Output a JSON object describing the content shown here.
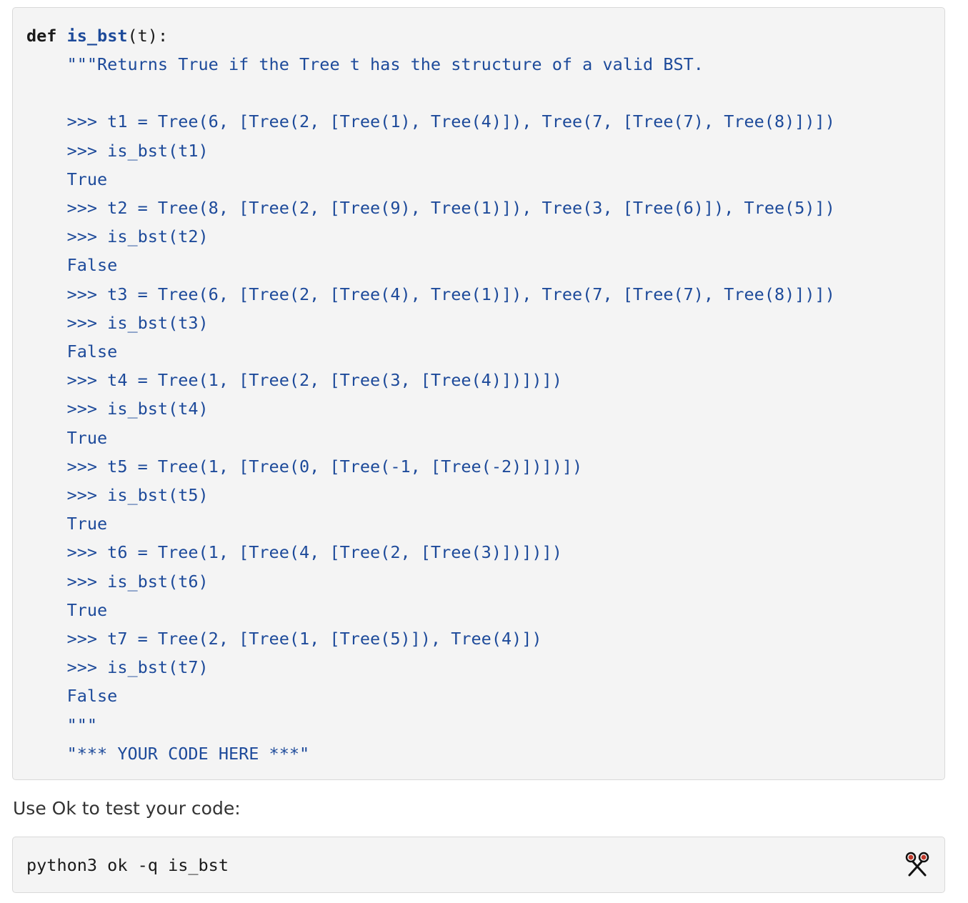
{
  "code_block": {
    "def_keyword": "def",
    "function_name": "is_bst",
    "signature_rest": "(t):",
    "lines": [
      "    \"\"\"Returns True if the Tree t has the structure of a valid BST.",
      "",
      "    >>> t1 = Tree(6, [Tree(2, [Tree(1), Tree(4)]), Tree(7, [Tree(7), Tree(8)])])",
      "    >>> is_bst(t1)",
      "    True",
      "    >>> t2 = Tree(8, [Tree(2, [Tree(9), Tree(1)]), Tree(3, [Tree(6)]), Tree(5)])",
      "    >>> is_bst(t2)",
      "    False",
      "    >>> t3 = Tree(6, [Tree(2, [Tree(4), Tree(1)]), Tree(7, [Tree(7), Tree(8)])])",
      "    >>> is_bst(t3)",
      "    False",
      "    >>> t4 = Tree(1, [Tree(2, [Tree(3, [Tree(4)])])])",
      "    >>> is_bst(t4)",
      "    True",
      "    >>> t5 = Tree(1, [Tree(0, [Tree(-1, [Tree(-2)])])])",
      "    >>> is_bst(t5)",
      "    True",
      "    >>> t6 = Tree(1, [Tree(4, [Tree(2, [Tree(3)])])])",
      "    >>> is_bst(t6)",
      "    True",
      "    >>> t7 = Tree(2, [Tree(1, [Tree(5)]), Tree(4)])",
      "    >>> is_bst(t7)",
      "    False",
      "    \"\"\"",
      "    \"*** YOUR CODE HERE ***\""
    ]
  },
  "instruction_text": "Use Ok to test your code:",
  "command_block": {
    "command": "python3 ok -q is_bst",
    "copy_icon": "scissors-icon"
  },
  "colors": {
    "code_background": "#f4f4f4",
    "code_border": "#d9d9d9",
    "docstring_blue": "#1d4a9a",
    "text_dark": "#1a1a1a",
    "icon_red": "#c0392b"
  }
}
